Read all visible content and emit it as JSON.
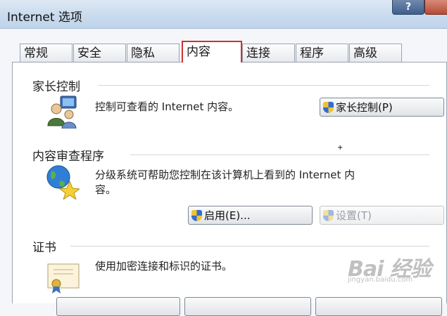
{
  "window": {
    "title": "Internet 选项",
    "help_label": "?"
  },
  "tabs": [
    {
      "label": "常规"
    },
    {
      "label": "安全"
    },
    {
      "label": "隐私"
    },
    {
      "label": "内容",
      "active": true
    },
    {
      "label": "连接"
    },
    {
      "label": "程序"
    },
    {
      "label": "高级"
    }
  ],
  "parental": {
    "heading": "家长控制",
    "description": "控制可查看的 Internet 内容。",
    "button_label": "家长控制(P)",
    "icon": "parental-control-people-icon"
  },
  "content_advisor": {
    "heading": "内容审查程序",
    "description_line1": "分级系统可帮助您控制在该计算机上看到的 Internet 内",
    "description_line2": "容。",
    "enable_label": "启用(E)...",
    "settings_label": "设置(T)",
    "settings_enabled": false,
    "icon": "globe-star-icon"
  },
  "certificates": {
    "heading": "证书",
    "description": "使用加密连接和标识的证书。",
    "icon": "certificate-icon"
  },
  "watermark": {
    "main": "Bai 经验",
    "sub": "jingyan.baidu.com"
  },
  "colors": {
    "active_tab_border": "#cc3333",
    "titlebar": "#c9dbee",
    "accent": "#2e6fd0"
  }
}
